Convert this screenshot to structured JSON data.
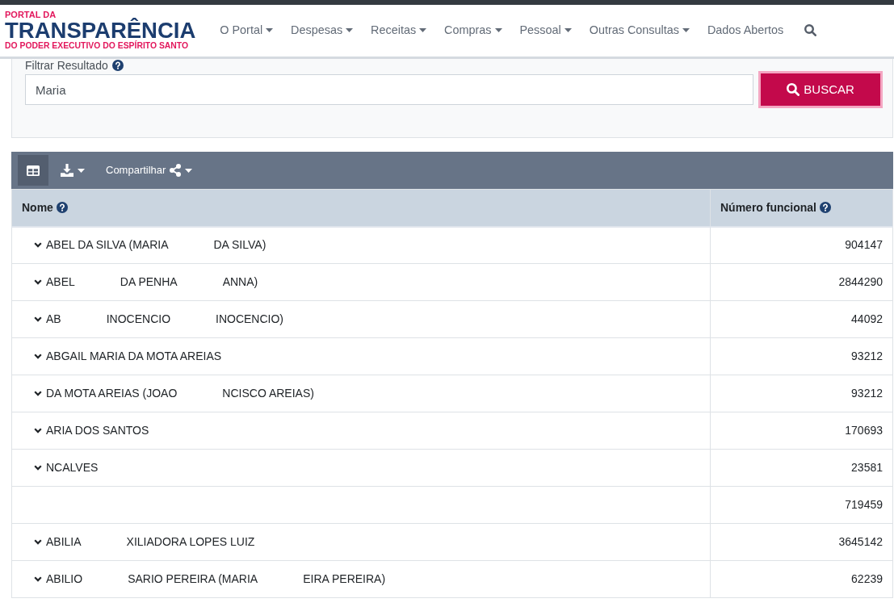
{
  "logo": {
    "top": "PORTAL DA",
    "main": "TRANSPARÊNCIA",
    "bottom": "DO PODER EXECUTIVO DO ESPÍRITO SANTO"
  },
  "nav": {
    "items": [
      {
        "label": "O Portal",
        "kind": "dropdown"
      },
      {
        "label": "Despesas",
        "kind": "dropdown"
      },
      {
        "label": "Receitas",
        "kind": "dropdown"
      },
      {
        "label": "Compras",
        "kind": "dropdown"
      },
      {
        "label": "Pessoal",
        "kind": "dropdown"
      },
      {
        "label": "Outras Consultas",
        "kind": "dropdown"
      },
      {
        "label": "Dados Abertos",
        "kind": "link"
      }
    ]
  },
  "filter": {
    "label": "Filtrar Resultado",
    "value": "Maria",
    "button": "BUSCAR"
  },
  "toolbar": {
    "buttons": [
      {
        "kind": "table-view",
        "selected": true
      },
      {
        "kind": "download",
        "selected": false
      },
      {
        "kind": "share",
        "label": "Compartilhar",
        "selected": false
      }
    ]
  },
  "table": {
    "columns": [
      {
        "label": "Nome"
      },
      {
        "label": "Número funcional"
      }
    ],
    "rows": [
      {
        "expandable": true,
        "name_parts": [
          "ABEL DA SILVA (MARIA",
          "DA SILVA)"
        ],
        "number": "904147"
      },
      {
        "expandable": true,
        "name_parts": [
          "ABEL",
          "DA PENHA",
          "ANNA)"
        ],
        "number": "2844290"
      },
      {
        "expandable": true,
        "name_parts": [
          "AB",
          "INOCENCIO",
          "INOCENCIO)"
        ],
        "number": "44092"
      },
      {
        "expandable": true,
        "name_parts": [
          "ABGAIL MARIA DA MOTA AREIAS"
        ],
        "number": "93212"
      },
      {
        "expandable": true,
        "name_parts": [
          "DA MOTA AREIAS (JOAO",
          "NCISCO AREIAS)"
        ],
        "number": "93212"
      },
      {
        "expandable": true,
        "name_parts": [
          "ARIA DOS SANTOS"
        ],
        "number": "170693"
      },
      {
        "expandable": true,
        "name_parts": [
          "NCALVES"
        ],
        "number": "23581"
      },
      {
        "expandable": false,
        "number": "719459"
      },
      {
        "expandable": true,
        "name_parts": [
          "ABILIA",
          "XILIADORA LOPES LUIZ"
        ],
        "number": "3645142"
      },
      {
        "expandable": true,
        "name_parts": [
          "ABILIO",
          "SARIO PEREIRA (MARIA",
          "EIRA PEREIRA)"
        ],
        "number": "62239"
      }
    ]
  }
}
